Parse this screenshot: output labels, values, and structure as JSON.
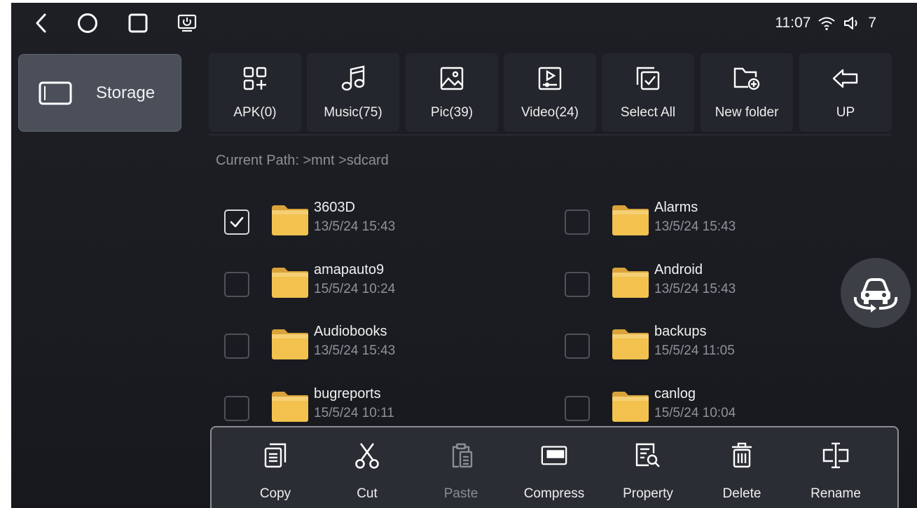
{
  "status_bar": {
    "time": "11:07",
    "volume": "7"
  },
  "sidebar": {
    "items": [
      {
        "label": "Storage"
      }
    ]
  },
  "toolbar": {
    "buttons": [
      {
        "label": "APK(0)"
      },
      {
        "label": "Music(75)"
      },
      {
        "label": "Pic(39)"
      },
      {
        "label": "Video(24)"
      },
      {
        "label": "Select All"
      },
      {
        "label": "New folder"
      },
      {
        "label": "UP"
      }
    ]
  },
  "path": {
    "text": "Current Path:  >mnt >sdcard"
  },
  "files": [
    {
      "name": "3603D",
      "date": "13/5/24 15:43",
      "checked": true
    },
    {
      "name": "Alarms",
      "date": "13/5/24 15:43",
      "checked": false
    },
    {
      "name": "amapauto9",
      "date": "15/5/24 10:24",
      "checked": false
    },
    {
      "name": "Android",
      "date": "13/5/24 15:43",
      "checked": false
    },
    {
      "name": "Audiobooks",
      "date": "13/5/24 15:43",
      "checked": false
    },
    {
      "name": "backups",
      "date": "15/5/24 11:05",
      "checked": false
    },
    {
      "name": "bugreports",
      "date": "15/5/24 10:11",
      "checked": false
    },
    {
      "name": "canlog",
      "date": "15/5/24 10:04",
      "checked": false
    }
  ],
  "actions": [
    {
      "label": "Copy",
      "enabled": true
    },
    {
      "label": "Cut",
      "enabled": true
    },
    {
      "label": "Paste",
      "enabled": false
    },
    {
      "label": "Compress",
      "enabled": true
    },
    {
      "label": "Property",
      "enabled": true
    },
    {
      "label": "Delete",
      "enabled": true
    },
    {
      "label": "Rename",
      "enabled": true
    }
  ],
  "colors": {
    "background": "#1b1d22",
    "panel": "#23262c",
    "selected": "#4a4f5a",
    "folder": "#f2c14e",
    "text": "#f1f1f1",
    "muted": "#8f9298"
  }
}
